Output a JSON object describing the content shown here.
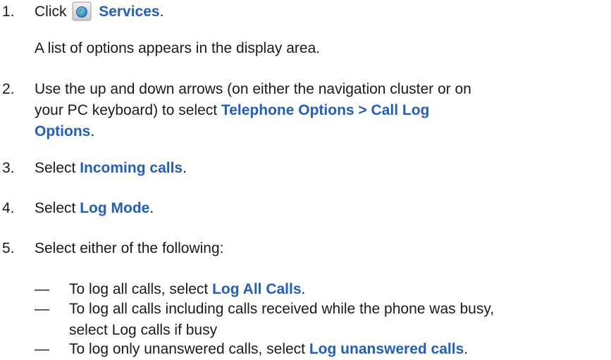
{
  "steps": [
    {
      "number": "1.",
      "prefix": "Click",
      "ui": "Services",
      "suffix": ".",
      "icon": "globe-icon",
      "result": "A  list of options appears in the display area."
    },
    {
      "number": "2.",
      "line1": "Use the up and down arrows (on either the navigation cluster or on",
      "line2_prefix": "your PC keyboard) to select",
      "line2_ui": "Telephone Options > Call Log",
      "line3_ui": "Options",
      "line3_suffix": "."
    },
    {
      "number": "3.",
      "prefix": "Select",
      "ui": "Incoming calls",
      "suffix": "."
    },
    {
      "number": "4.",
      "prefix": "Select",
      "ui": "Log Mode",
      "suffix": "."
    },
    {
      "number": "5.",
      "text": "Select either of the following:"
    }
  ],
  "options": [
    {
      "dash": "—",
      "prefix": "To log all calls, select",
      "ui": "Log All Calls",
      "suffix": "."
    },
    {
      "dash": "—",
      "line1": "To log all calls including calls received while the phone was busy,",
      "line2": "select Log calls if busy"
    },
    {
      "dash": "—",
      "prefix": "To log only unanswered calls, select",
      "ui": "Log unanswered calls",
      "suffix": "."
    }
  ],
  "colors": {
    "ui_text": "#1f5fbf",
    "body_text": "#1a1a1a"
  }
}
